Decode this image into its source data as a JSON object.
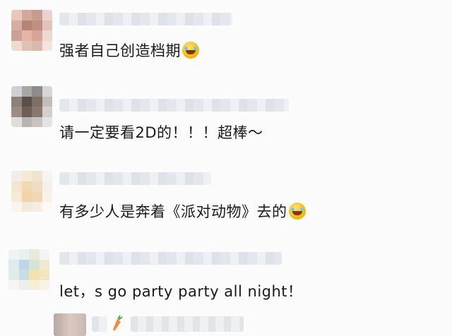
{
  "comments": [
    {
      "text": "强者自己创造档期",
      "emoji": "laughing-crying-emoji"
    },
    {
      "text": "请一定要看2D的！！！超棒～"
    },
    {
      "text": "有多少人是奔着《派对动物》去的",
      "emoji": "laughing-crying-emoji"
    },
    {
      "text": "let，s  go  party party all night！"
    }
  ],
  "colors": {
    "background": "#fbfbfb",
    "text": "#1a1a1a"
  }
}
